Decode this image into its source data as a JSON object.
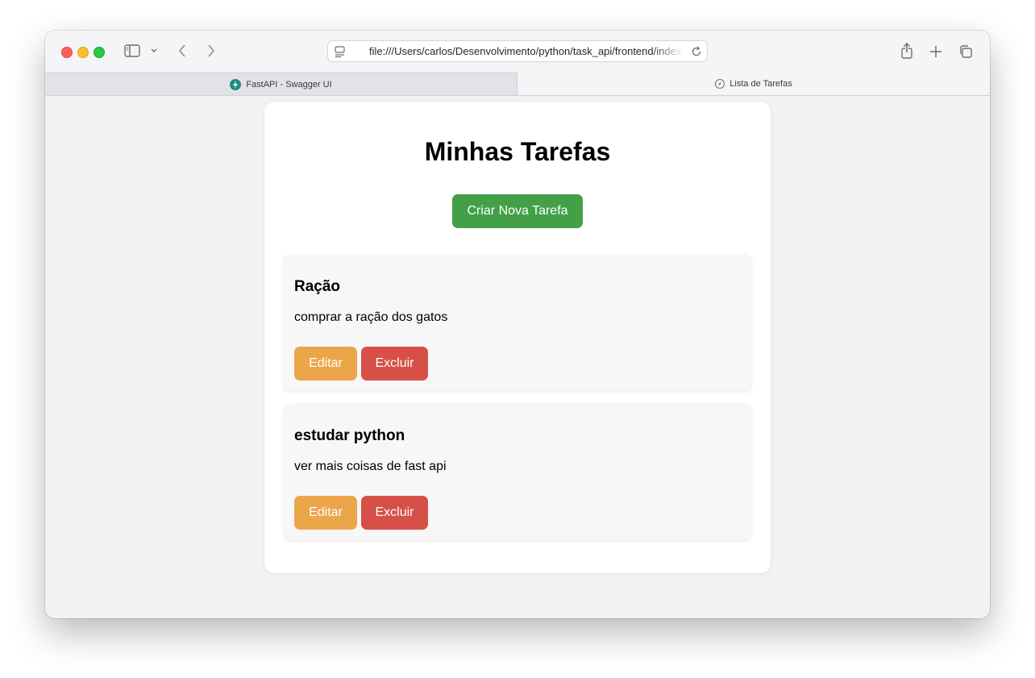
{
  "browser": {
    "url": "file:///Users/carlos/Desenvolvimento/python/task_api/frontend/index.html",
    "tabs": [
      {
        "label": "FastAPI - Swagger UI",
        "icon": "fastapi-icon"
      },
      {
        "label": "Lista de Tarefas",
        "icon": "compass-icon"
      }
    ]
  },
  "page": {
    "title": "Minhas Tarefas",
    "create_label": "Criar Nova Tarefa"
  },
  "tasks": [
    {
      "title": "Ração",
      "description": "comprar a ração dos gatos",
      "edit_label": "Editar",
      "delete_label": "Excluir"
    },
    {
      "title": "estudar python",
      "description": "ver mais coisas de fast api",
      "edit_label": "Editar",
      "delete_label": "Excluir"
    }
  ],
  "colors": {
    "create": "#43a047",
    "edit": "#eca64a",
    "delete": "#d75048"
  }
}
